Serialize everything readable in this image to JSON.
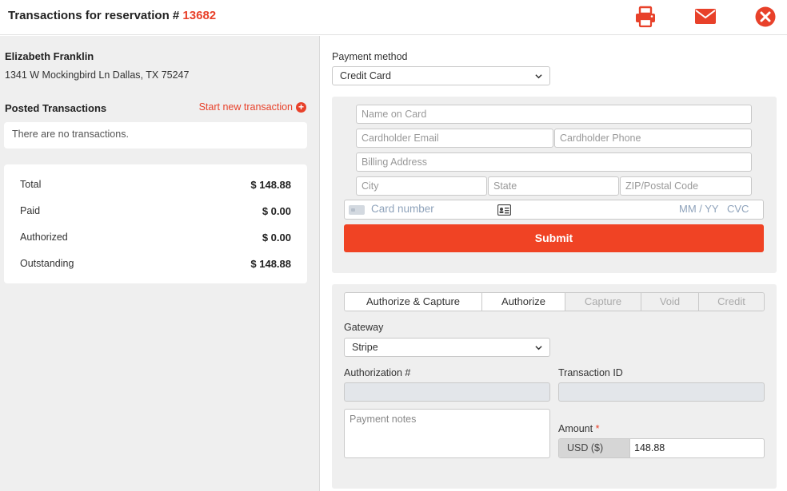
{
  "header": {
    "title_prefix": "Transactions for reservation #",
    "reservation_number": "13682",
    "icons": [
      "print-icon",
      "envelope-icon",
      "close-circle-icon"
    ],
    "accent_color": "#e8412a"
  },
  "guest": {
    "name": "Elizabeth Franklin",
    "address": "1341 W Mockingbird Ln Dallas, TX 75247"
  },
  "posted": {
    "title": "Posted Transactions",
    "start_new_label": "Start new transaction",
    "empty_text": "There are no transactions."
  },
  "totals": [
    {
      "label": "Total",
      "value": "$ 148.88"
    },
    {
      "label": "Paid",
      "value": "$ 0.00"
    },
    {
      "label": "Authorized",
      "value": "$ 0.00"
    },
    {
      "label": "Outstanding",
      "value": "$ 148.88"
    }
  ],
  "payment": {
    "method_label": "Payment method",
    "method_value": "Credit Card"
  },
  "card": {
    "name_placeholder": "Name on Card",
    "email_placeholder": "Cardholder Email",
    "phone_placeholder": "Cardholder Phone",
    "billing_placeholder": "Billing Address",
    "city_placeholder": "City",
    "state_placeholder": "State",
    "zip_placeholder": "ZIP/Postal Code",
    "number_placeholder": "Card number",
    "expiry_placeholder": "MM / YY",
    "cvc_placeholder": "CVC",
    "submit_label": "Submit",
    "submit_color": "#f04324"
  },
  "transaction": {
    "tabs": [
      {
        "label": "Authorize & Capture",
        "enabled": true
      },
      {
        "label": "Authorize",
        "enabled": true
      },
      {
        "label": "Capture",
        "enabled": false
      },
      {
        "label": "Void",
        "enabled": false
      },
      {
        "label": "Credit",
        "enabled": false
      }
    ],
    "gateway_label": "Gateway",
    "gateway_value": "Stripe",
    "auth_label": "Authorization #",
    "txid_label": "Transaction ID",
    "notes_placeholder": "Payment notes",
    "amount_label": "Amount",
    "required_mark": "*",
    "currency": "USD ($)",
    "amount_value": "148.88"
  }
}
